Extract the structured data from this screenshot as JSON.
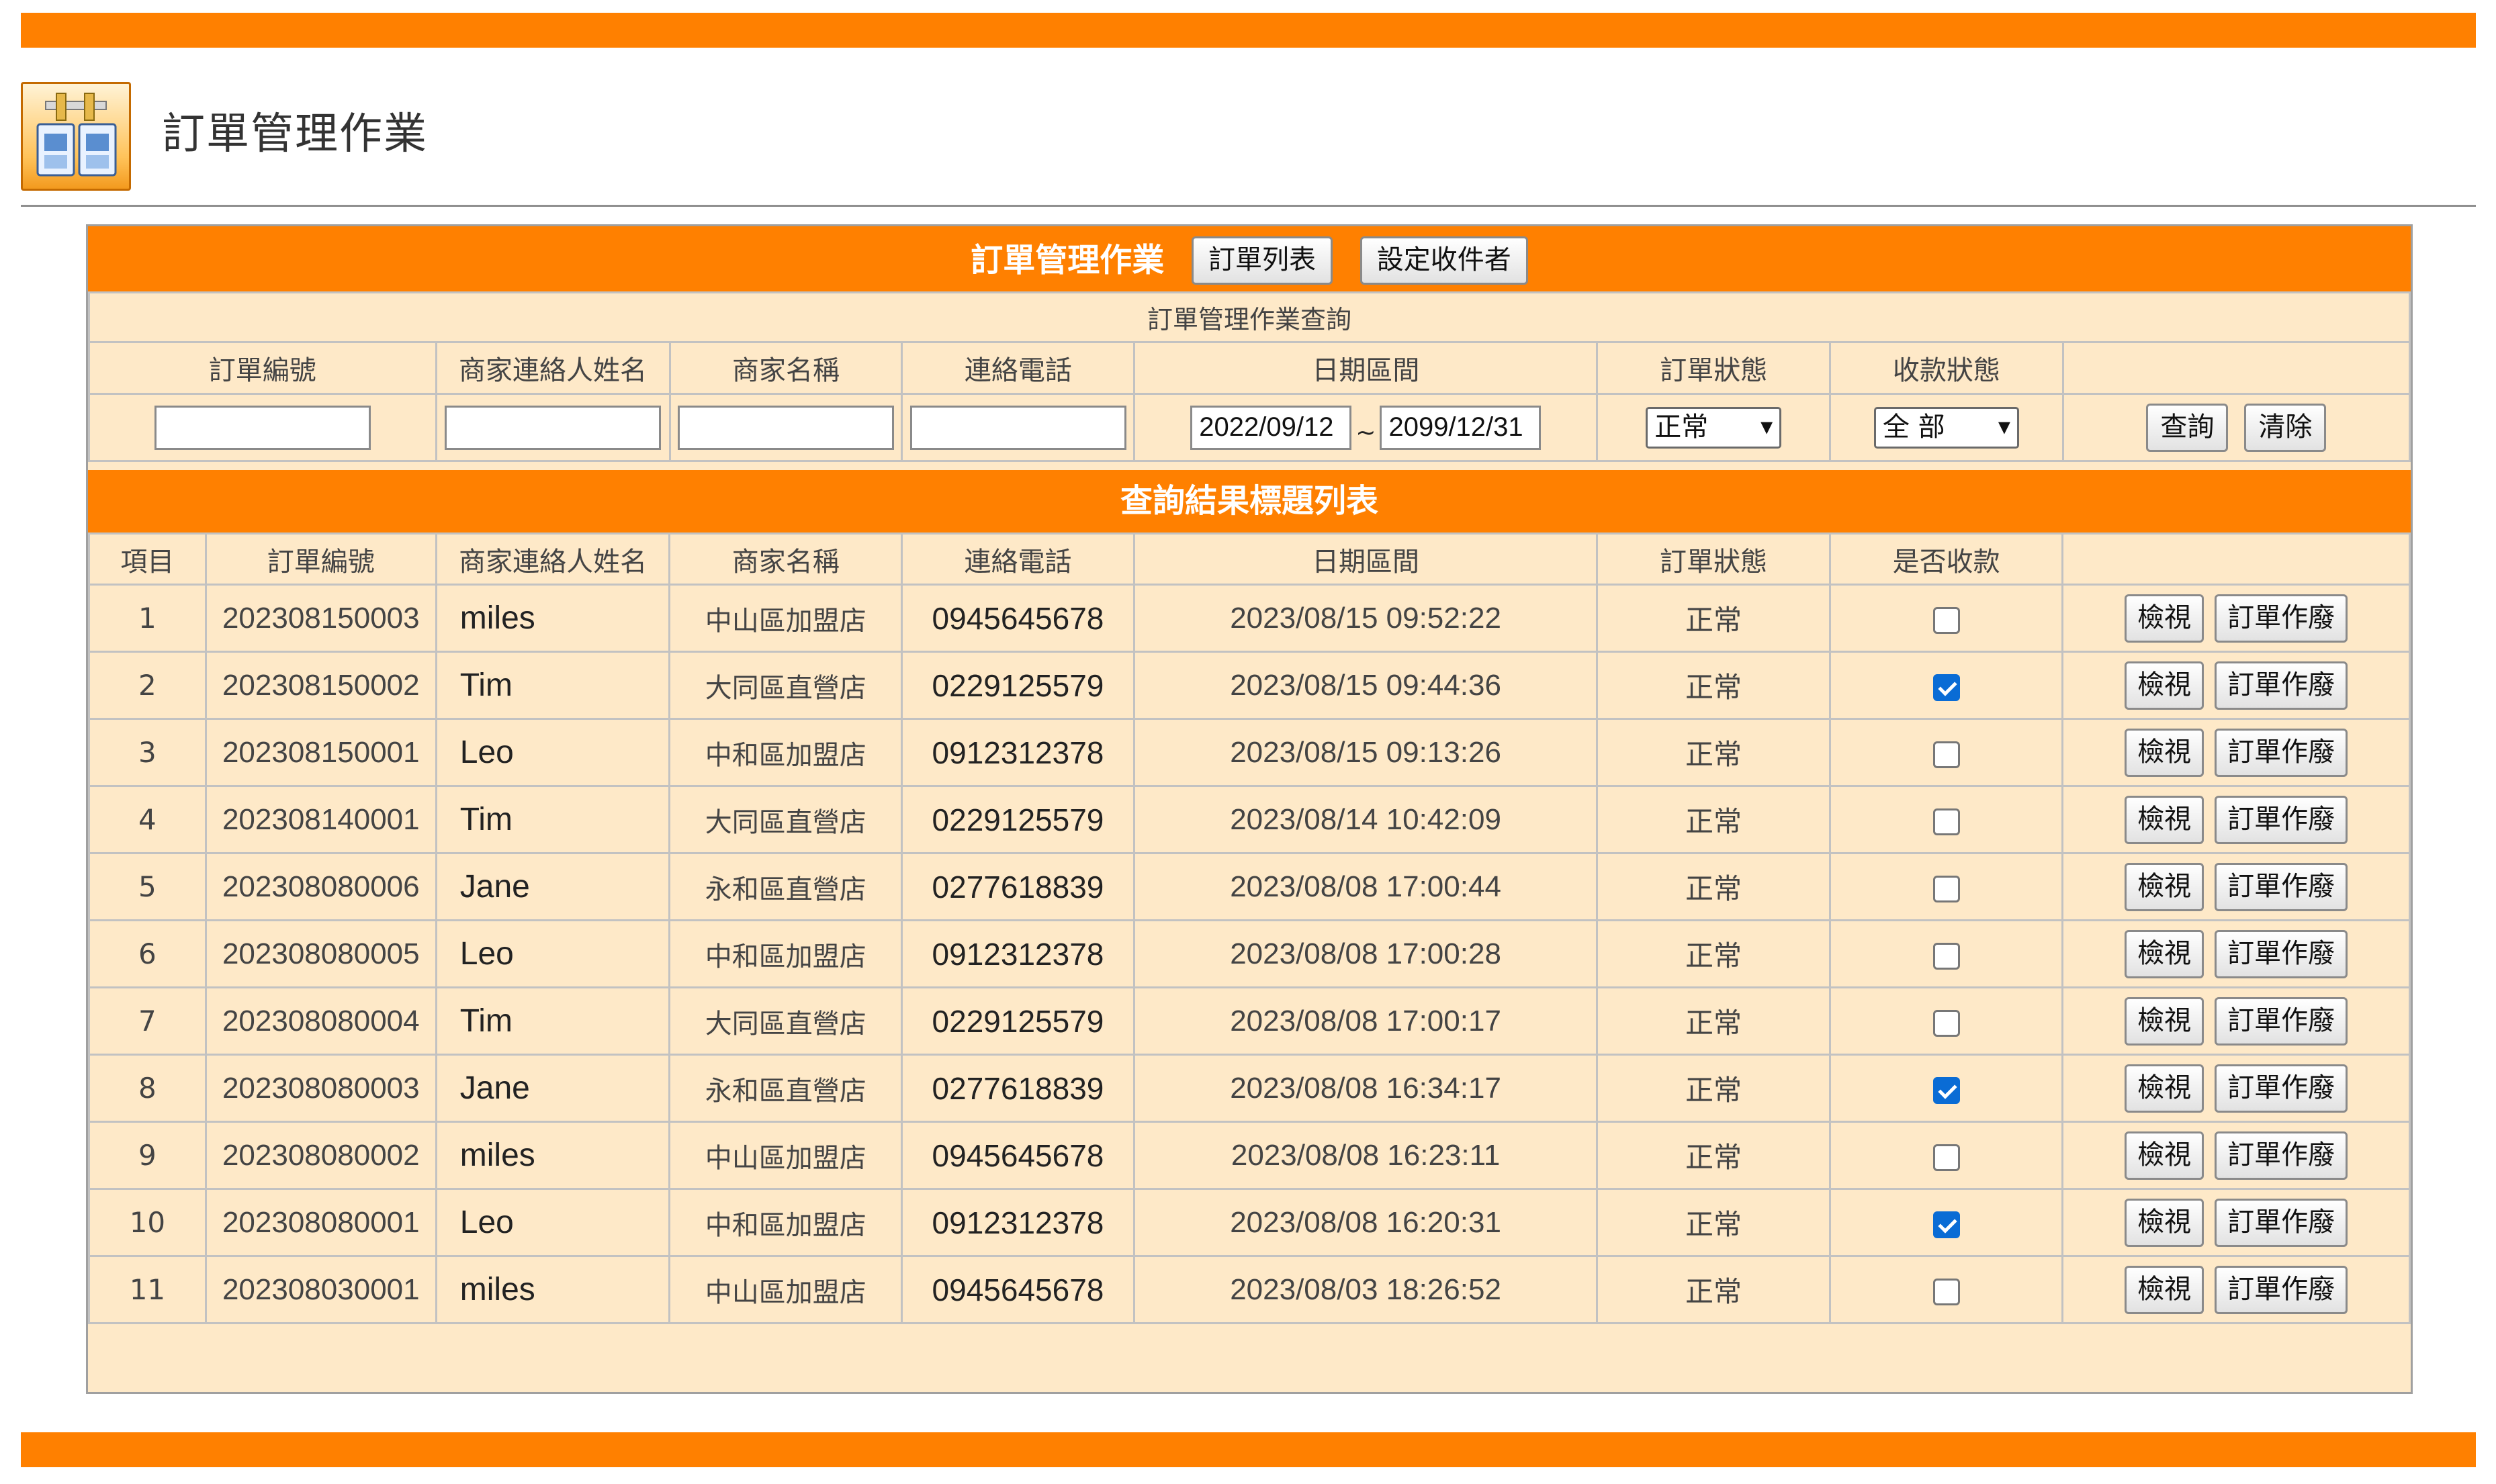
{
  "page": {
    "title": "訂單管理作業"
  },
  "query": {
    "header_title": "訂單管理作業",
    "btn_order_list": "訂單列表",
    "btn_set_recipient": "設定收件者",
    "sub_title": "訂單管理作業查詢",
    "columns": [
      "訂單編號",
      "商家連絡人姓名",
      "商家名稱",
      "連絡電話",
      "日期區間",
      "訂單狀態",
      "收款狀態"
    ],
    "order_no": "",
    "contact_name": "",
    "store_name": "",
    "phone": "",
    "date_from": "2022/09/12",
    "date_sep": "~",
    "date_to": "2099/12/31",
    "order_status": "正常",
    "payment_status": "全 部",
    "btn_search": "查詢",
    "btn_clear": "清除"
  },
  "results": {
    "title": "查詢結果標題列表",
    "columns": [
      "項目",
      "訂單編號",
      "商家連絡人姓名",
      "商家名稱",
      "連絡電話",
      "日期區間",
      "訂單狀態",
      "是否收款"
    ],
    "btn_view": "檢視",
    "btn_void": "訂單作廢",
    "rows": [
      {
        "no": "1",
        "order_no": "202308150003",
        "contact": "miles",
        "store": "中山區加盟店",
        "phone": "0945645678",
        "date": "2023/08/15 09:52:22",
        "status": "正常",
        "paid": false
      },
      {
        "no": "2",
        "order_no": "202308150002",
        "contact": "Tim",
        "store": "大同區直營店",
        "phone": "0229125579",
        "date": "2023/08/15 09:44:36",
        "status": "正常",
        "paid": true
      },
      {
        "no": "3",
        "order_no": "202308150001",
        "contact": "Leo",
        "store": "中和區加盟店",
        "phone": "0912312378",
        "date": "2023/08/15 09:13:26",
        "status": "正常",
        "paid": false
      },
      {
        "no": "4",
        "order_no": "202308140001",
        "contact": "Tim",
        "store": "大同區直營店",
        "phone": "0229125579",
        "date": "2023/08/14 10:42:09",
        "status": "正常",
        "paid": false
      },
      {
        "no": "5",
        "order_no": "202308080006",
        "contact": "Jane",
        "store": "永和區直營店",
        "phone": "0277618839",
        "date": "2023/08/08 17:00:44",
        "status": "正常",
        "paid": false
      },
      {
        "no": "6",
        "order_no": "202308080005",
        "contact": "Leo",
        "store": "中和區加盟店",
        "phone": "0912312378",
        "date": "2023/08/08 17:00:28",
        "status": "正常",
        "paid": false
      },
      {
        "no": "7",
        "order_no": "202308080004",
        "contact": "Tim",
        "store": "大同區直營店",
        "phone": "0229125579",
        "date": "2023/08/08 17:00:17",
        "status": "正常",
        "paid": false
      },
      {
        "no": "8",
        "order_no": "202308080003",
        "contact": "Jane",
        "store": "永和區直營店",
        "phone": "0277618839",
        "date": "2023/08/08 16:34:17",
        "status": "正常",
        "paid": true
      },
      {
        "no": "9",
        "order_no": "202308080002",
        "contact": "miles",
        "store": "中山區加盟店",
        "phone": "0945645678",
        "date": "2023/08/08 16:23:11",
        "status": "正常",
        "paid": false
      },
      {
        "no": "10",
        "order_no": "202308080001",
        "contact": "Leo",
        "store": "中和區加盟店",
        "phone": "0912312378",
        "date": "2023/08/08 16:20:31",
        "status": "正常",
        "paid": true
      },
      {
        "no": "11",
        "order_no": "202308030001",
        "contact": "miles",
        "store": "中山區加盟店",
        "phone": "0945645678",
        "date": "2023/08/03 18:26:52",
        "status": "正常",
        "paid": false
      }
    ]
  },
  "colors": {
    "accent": "#ff8000",
    "panel_bg": "#fee9c8",
    "checkbox_checked": "#0a6cd5"
  },
  "icons": {
    "app": "order-management-app-icon"
  }
}
